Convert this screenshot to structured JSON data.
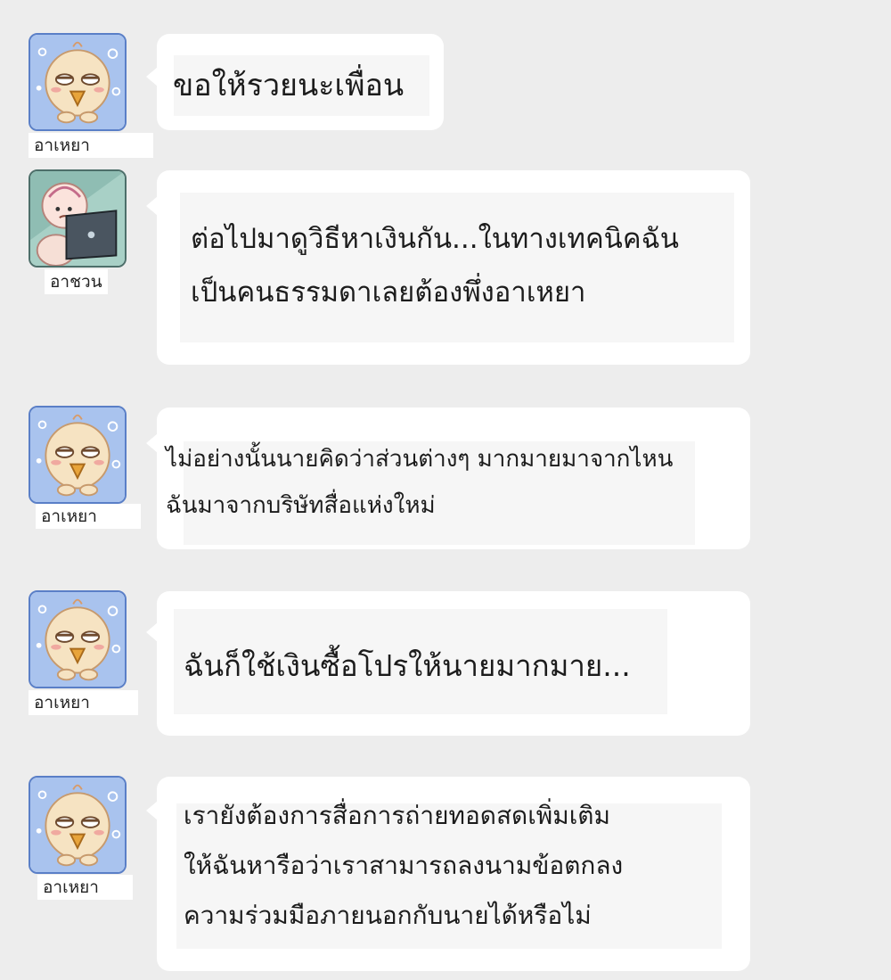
{
  "messages": [
    {
      "sender": "อาเหยา",
      "avatar_icon": "chick-avatar-icon",
      "lines": [
        "ขอให้รวยนะเพื่อน"
      ]
    },
    {
      "sender": "อาชวน",
      "avatar_icon": "baby-laptop-avatar-icon",
      "lines": [
        "ต่อไปมาดูวิธีหาเงินกัน...ในทางเทคนิคฉัน",
        "เป็นคนธรรมดาเลยต้องพึ่งอาเหยา"
      ]
    },
    {
      "sender": "อาเหยา",
      "avatar_icon": "chick-avatar-icon",
      "lines": [
        "ไม่อย่างนั้นนายคิดว่าส่วนต่างๆ มากมายมาจากไหน",
        "ฉันมาจากบริษัทสื่อแห่งใหม่"
      ]
    },
    {
      "sender": "อาเหยา",
      "avatar_icon": "chick-avatar-icon",
      "lines": [
        "ฉันก็ใช้เงินซื้อโปรให้นายมากมาย..."
      ]
    },
    {
      "sender": "อาเหยา",
      "avatar_icon": "chick-avatar-icon",
      "lines": [
        "เรายังต้องการสื่อการถ่ายทอดสดเพิ่มเติม",
        "ให้ฉันหารือว่าเราสามารถลงนามข้อตกลง",
        "ความร่วมมือภายนอกกับนายได้หรือไม่"
      ]
    }
  ],
  "colors": {
    "background": "#ededed",
    "bubble": "#ffffff",
    "avatar_chick_bg": "#a9c3ee",
    "avatar_baby_bg": "#a8d0c6"
  }
}
